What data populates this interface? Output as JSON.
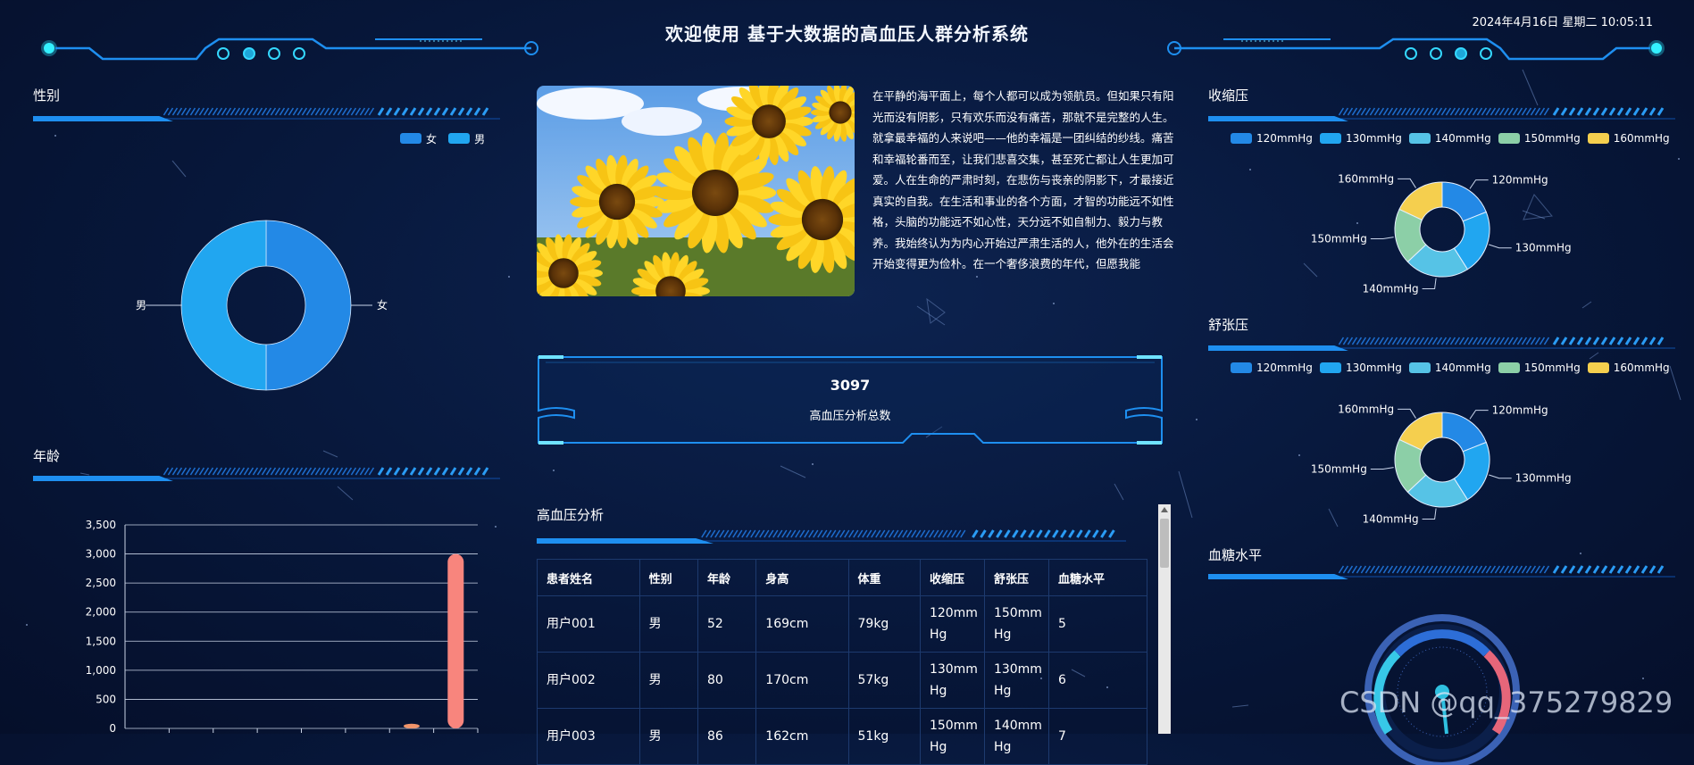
{
  "header": {
    "title": "欢迎使用 基于大数据的高血压人群分析系统",
    "datetime": "2024年4月16日 星期二 10:05:11"
  },
  "gender": {
    "title": "性别",
    "legend": [
      {
        "label": "女",
        "color": "#2389e6"
      },
      {
        "label": "男",
        "color": "#21a6f0"
      }
    ],
    "labels": {
      "female": "女",
      "male": "男"
    },
    "values": {
      "female": 0.5,
      "male": 0.5
    }
  },
  "age": {
    "title": "年龄",
    "chart_data": {
      "type": "bar",
      "yticks": [
        "3,500",
        "3,000",
        "2,500",
        "2,000",
        "1,500",
        "1,000",
        "500",
        "0"
      ],
      "ylim": [
        0,
        3500
      ],
      "categories": [
        "",
        "",
        "",
        "",
        "",
        "",
        "",
        ""
      ],
      "values": [
        0,
        0,
        0,
        0,
        0,
        0,
        80,
        3000
      ],
      "colors": [
        "#f8857d",
        "#f8857d",
        "#f8857d",
        "#f8857d",
        "#f8857d",
        "#f8857d",
        "#f0946a",
        "#f8857d"
      ]
    }
  },
  "article": {
    "text": "在平静的海平面上，每个人都可以成为领航员。但如果只有阳光而没有阴影，只有欢乐而没有痛苦，那就不是完整的人生。就拿最幸福的人来说吧——他的幸福是一团纠结的纱线。痛苦和幸福轮番而至，让我们悲喜交集，甚至死亡都让人生更加可爱。人在生命的严肃时刻，在悲伤与丧亲的阴影下，才最接近真实的自我。在生活和事业的各个方面，才智的功能远不如性格，头脑的功能远不如心性，天分远不如自制力、毅力与教养。我始终认为为内心开始过严肃生活的人，他外在的生活会开始变得更为俭朴。在一个奢侈浪费的年代，但愿我能"
  },
  "total": {
    "value": "3097",
    "label": "高血压分析总数"
  },
  "analysis": {
    "title": "高血压分析",
    "columns": [
      "患者姓名",
      "性别",
      "年龄",
      "身高",
      "体重",
      "收缩压",
      "舒张压",
      "血糖水平"
    ],
    "rows": [
      [
        "用户001",
        "男",
        "52",
        "169cm",
        "79kg",
        "120mmHg",
        "150mmHg",
        "5"
      ],
      [
        "用户002",
        "男",
        "80",
        "170cm",
        "57kg",
        "130mmHg",
        "130mmHg",
        "6"
      ],
      [
        "用户003",
        "男",
        "86",
        "162cm",
        "51kg",
        "150mmHg",
        "140mmHg",
        "7"
      ]
    ]
  },
  "bp_legend": [
    {
      "label": "120mmHg",
      "color": "#2389e6"
    },
    {
      "label": "130mmHg",
      "color": "#21a6f0"
    },
    {
      "label": "140mmHg",
      "color": "#56c3e6"
    },
    {
      "label": "150mmHg",
      "color": "#8ccfa7"
    },
    {
      "label": "160mmHg",
      "color": "#f5cf4e"
    }
  ],
  "systolic": {
    "title": "收缩压",
    "labels": [
      "120mmHg",
      "130mmHg",
      "140mmHg",
      "150mmHg",
      "160mmHg"
    ],
    "values": [
      0.19,
      0.22,
      0.22,
      0.19,
      0.18
    ]
  },
  "diastolic": {
    "title": "舒张压",
    "labels": [
      "120mmHg",
      "130mmHg",
      "140mmHg",
      "150mmHg",
      "160mmHg"
    ],
    "values": [
      0.19,
      0.22,
      0.22,
      0.19,
      0.18
    ]
  },
  "glucose": {
    "title": "血糖水平"
  },
  "watermark": "CSDN @qq_375279829"
}
